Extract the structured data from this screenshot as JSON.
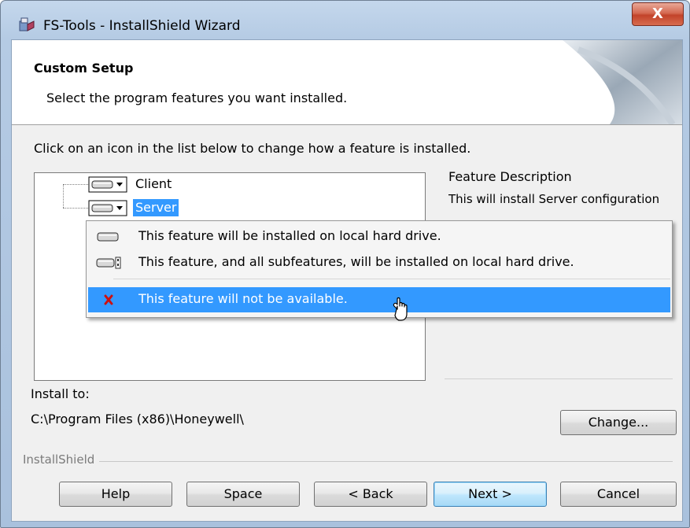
{
  "window": {
    "title": "FS-Tools - InstallShield Wizard",
    "close_glyph": "X"
  },
  "banner": {
    "title": "Custom Setup",
    "subtitle": "Select the program features you want installed."
  },
  "instruction": "Click on an icon in the list below to change how a feature is installed.",
  "tree": {
    "items": [
      {
        "label": "Client",
        "icon": "hard-drive-icon",
        "selected": false
      },
      {
        "label": "Server",
        "icon": "hard-drive-icon",
        "selected": true
      }
    ]
  },
  "description": {
    "title": "Feature Description",
    "text": "This will install Server configuration"
  },
  "install_to": {
    "label": "Install to:",
    "path": "C:\\Program Files (x86)\\Honeywell\\"
  },
  "buttons": {
    "change": "Change...",
    "help": "Help",
    "space": "Space",
    "back": "< Back",
    "next": "Next >",
    "cancel": "Cancel"
  },
  "brand": "InstallShield",
  "feature_menu": {
    "items": [
      {
        "label": "This feature will be installed on local hard drive.",
        "icon": "hard-drive-icon"
      },
      {
        "label": "This feature, and all subfeatures, will be installed on local hard drive.",
        "icon": "hard-drive-subfeatures-icon"
      },
      {
        "label": "This feature will not be available.",
        "icon": "red-x-icon",
        "highlighted": true
      }
    ]
  },
  "colors": {
    "selection": "#3399ff",
    "unavailable_x": "#cc1111"
  }
}
